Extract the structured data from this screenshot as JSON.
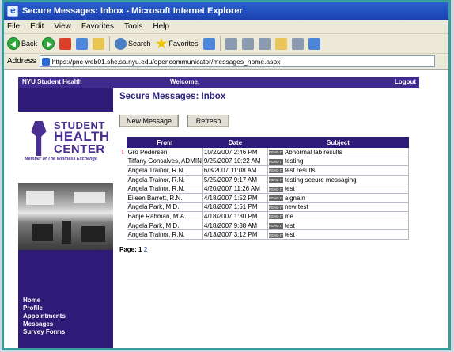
{
  "window": {
    "title": "Secure Messages: Inbox - Microsoft Internet Explorer"
  },
  "menu": [
    "File",
    "Edit",
    "View",
    "Favorites",
    "Tools",
    "Help"
  ],
  "toolbar": {
    "back": "Back",
    "search": "Search",
    "favorites": "Favorites"
  },
  "address": {
    "label": "Address",
    "url": "https://pnc-web01.shc.sa.nyu.edu/opencommunicator/messages_home.aspx"
  },
  "topnav": {
    "site": "NYU Student Health",
    "welcome": "Welcome,",
    "logout": "Logout"
  },
  "logo": {
    "line1": "STUDENT",
    "line2": "HEALTH",
    "line3": "CENTER",
    "tagline": "Member of The Wellness Exchange"
  },
  "sidenav": [
    "Home",
    "Profile",
    "Appointments",
    "Messages",
    "Survey Forms"
  ],
  "page": {
    "title": "Secure Messages: Inbox",
    "new_message": "New Message",
    "refresh": "Refresh"
  },
  "table": {
    "headers": [
      "From",
      "Date",
      "Subject"
    ],
    "read_badge": "READ IT",
    "rows": [
      {
        "flag": "!",
        "from": "Gro Pedersen,",
        "date": "10/2/2007 2:46 PM",
        "subject": "Abnormal lab results"
      },
      {
        "flag": "",
        "from": "Tiffany Gonsalves, ADMIN",
        "date": "9/25/2007 10:22 AM",
        "subject": "testing"
      },
      {
        "flag": "",
        "from": "Angela Trainor, R.N.",
        "date": "6/8/2007 11:08 AM",
        "subject": "test results"
      },
      {
        "flag": "",
        "from": "Angela Trainor, R.N.",
        "date": "5/25/2007 9:17 AM",
        "subject": "testing secure messaging"
      },
      {
        "flag": "",
        "from": "Angela Trainor, R.N.",
        "date": "4/20/2007 11:26 AM",
        "subject": "test"
      },
      {
        "flag": "",
        "from": "Eileen Barrett, R.N.",
        "date": "4/18/2007 1:52 PM",
        "subject": "algnaln"
      },
      {
        "flag": "",
        "from": "Angela Park, M.D.",
        "date": "4/18/2007 1:51 PM",
        "subject": "new test"
      },
      {
        "flag": "",
        "from": "Barije Rahman, M.A.",
        "date": "4/18/2007 1:30 PM",
        "subject": "me"
      },
      {
        "flag": "",
        "from": "Angela Park, M.D.",
        "date": "4/18/2007 9:38 AM",
        "subject": "test"
      },
      {
        "flag": "",
        "from": "Angela Trainor, R.N.",
        "date": "4/13/2007 3:12 PM",
        "subject": "test"
      }
    ]
  },
  "pager": {
    "label": "Page:",
    "current": "1",
    "other": "2"
  },
  "colors": {
    "nav": "#2d1b77",
    "accent": "#3a9c9a",
    "heading": "#2d2480"
  }
}
